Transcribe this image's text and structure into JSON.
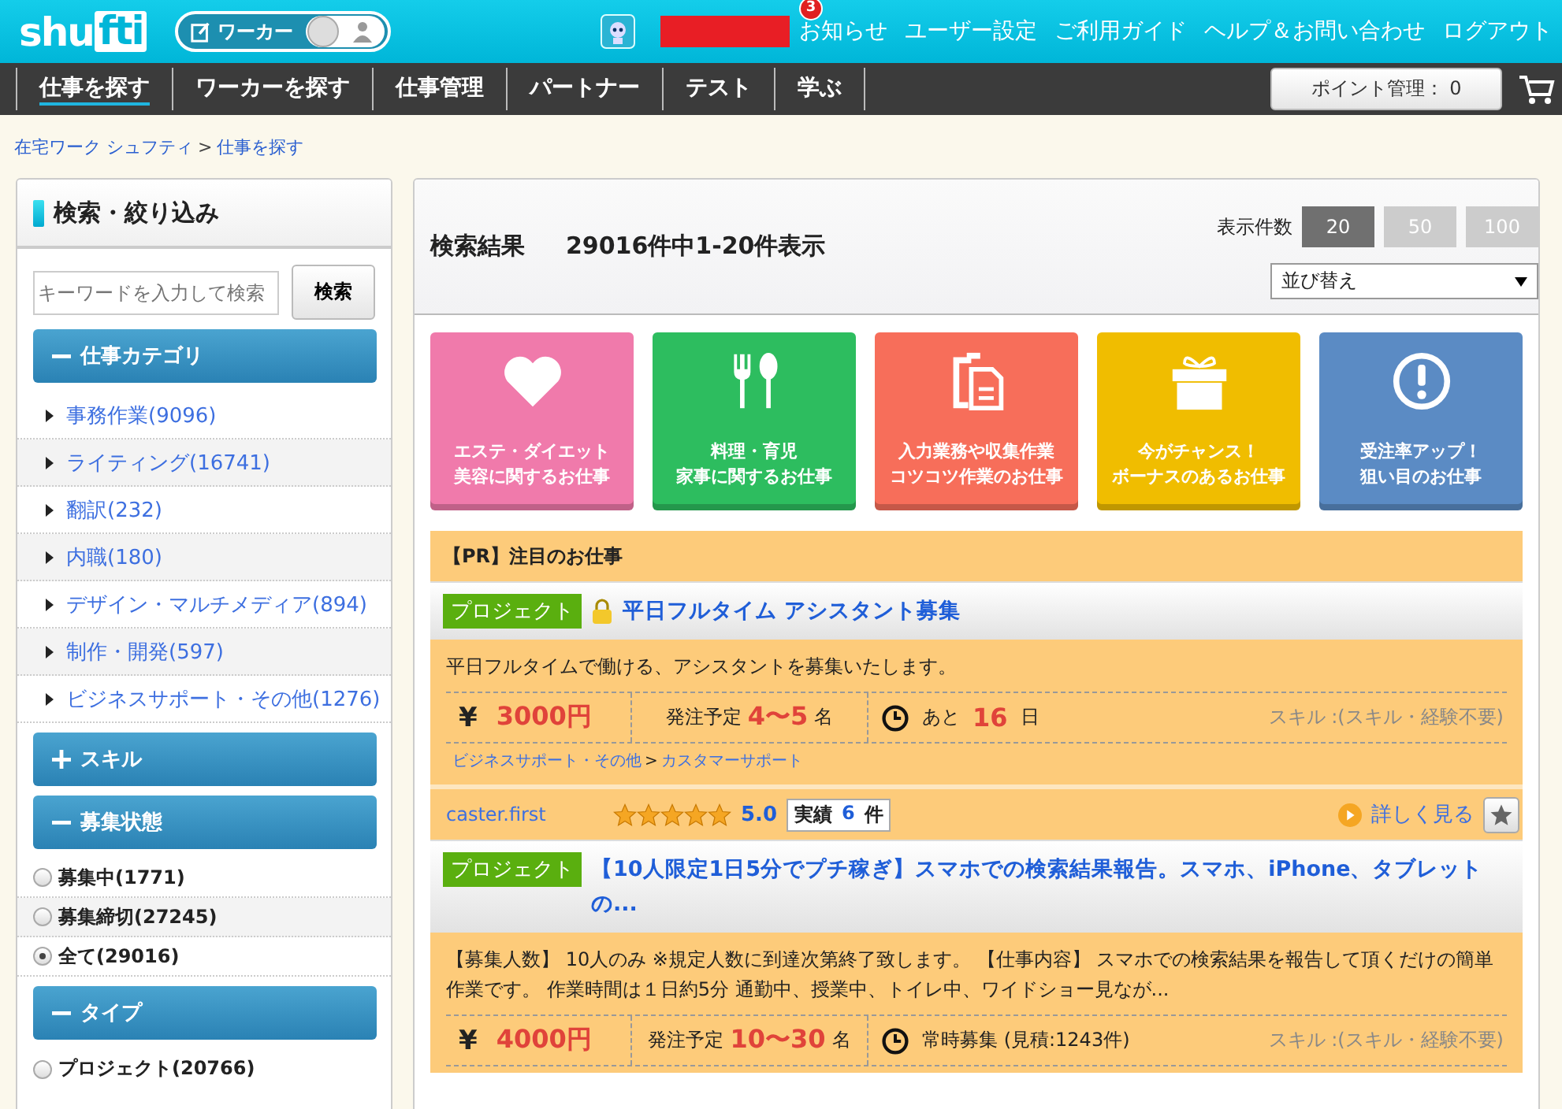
{
  "header": {
    "logo_text": "shu",
    "logo_box": "fti",
    "mode_toggle": {
      "label": "ワーカー",
      "on": false
    },
    "notification_badge": "3",
    "links": [
      "お知らせ",
      "ユーザー設定",
      "ご利用ガイド",
      "ヘルプ＆お問い合わせ",
      "ログアウト"
    ]
  },
  "nav": {
    "tabs": [
      {
        "label": "仕事を探す",
        "selected": true
      },
      {
        "label": "ワーカーを探す",
        "selected": false
      },
      {
        "label": "仕事管理",
        "selected": false
      },
      {
        "label": "パートナー",
        "selected": false
      },
      {
        "label": "テスト",
        "selected": false
      },
      {
        "label": "学ぶ",
        "selected": false
      }
    ],
    "points_button": "ポイント管理： 0"
  },
  "breadcrumb": {
    "separator": ">",
    "items": [
      "在宅ワーク シュフティ",
      "仕事を探す"
    ]
  },
  "sidebar": {
    "title": "検索・絞り込み",
    "search": {
      "placeholder": "キーワードを入力して検索",
      "button": "検索"
    },
    "sections": [
      {
        "title": "仕事カテゴリ",
        "expanded": true,
        "kind": "links",
        "items": [
          {
            "label": "事務作業(9096)"
          },
          {
            "label": "ライティング(16741)"
          },
          {
            "label": "翻訳(232)"
          },
          {
            "label": "内職(180)"
          },
          {
            "label": "デザイン・マルチメディア(894)"
          },
          {
            "label": "制作・開発(597)"
          },
          {
            "label": "ビジネスサポート・その他(1276)"
          }
        ]
      },
      {
        "title": "スキル",
        "expanded": false
      },
      {
        "title": "募集状態",
        "expanded": true,
        "kind": "radios",
        "items": [
          {
            "label": "募集中(1771)",
            "selected": false
          },
          {
            "label": "募集締切(27245)",
            "selected": false
          },
          {
            "label": "全て(29016)",
            "selected": true
          }
        ]
      },
      {
        "title": "タイプ",
        "expanded": true,
        "kind": "radios",
        "items": [
          {
            "label": "プロジェクト(20766)",
            "selected": false
          }
        ]
      }
    ]
  },
  "results": {
    "title": "検索結果",
    "count": "29016件中1-20件表示",
    "per_page_label": "表示件数",
    "per_page": [
      {
        "label": "20",
        "selected": true
      },
      {
        "label": "50",
        "selected": false
      },
      {
        "label": "100",
        "selected": false
      }
    ],
    "sort": {
      "value": "並び替え"
    },
    "tiles": [
      {
        "color": "#f07aab",
        "lines": [
          "エステ・ダイエット",
          "美容に関するお仕事"
        ]
      },
      {
        "color": "#2dbd5f",
        "lines": [
          "料理・育児",
          "家事に関するお仕事"
        ]
      },
      {
        "color": "#f76e5a",
        "lines": [
          "入力業務や収集作業",
          "コツコツ作業のお仕事"
        ]
      },
      {
        "color": "#f0bd00",
        "lines": [
          "今がチャンス！",
          "ボーナスのあるお仕事"
        ]
      },
      {
        "color": "#5b8bc4",
        "lines": [
          "受注率アップ！",
          "狙い目のお仕事"
        ]
      }
    ],
    "pr_heading": "【PR】注目のお仕事",
    "jobs": [
      {
        "type": "プロジェクト",
        "locked": true,
        "title": "平日フルタイム アシスタント募集",
        "description": "平日フルタイムで働ける、アシスタントを募集いたします。",
        "currency": "¥",
        "price": "3000円",
        "order_label": "発注予定",
        "order_count": "4〜5",
        "order_unit": "名",
        "deadline_prefix": "あと",
        "deadline_value": "16",
        "deadline_suffix": "日",
        "skill": "スキル :(スキル・経験不要)",
        "categories": [
          "ビジネスサポート・その他",
          "カスタマーサポート"
        ],
        "category_separator": ">",
        "client": {
          "name": "caster.first",
          "stars": 5,
          "rating": "5.0",
          "record_label": "実績",
          "record_count": "6",
          "record_unit": "件"
        },
        "details": "詳しく見る"
      },
      {
        "type": "プロジェクト",
        "locked": false,
        "title": "【10人限定1日5分でプチ稼ぎ】スマホでの検索結果報告。スマホ、iPhone、タブレットの...",
        "description": "【募集人数】 10人のみ ※規定人数に到達次第終了致します。 【仕事内容】 スマホでの検索結果を報告して頂くだけの簡単作業です。 作業時間は１日約5分 通勤中、授業中、トイレ中、ワイドショー見なが...",
        "currency": "¥",
        "price": "4000円",
        "order_label": "発注予定",
        "order_count": "10〜30",
        "order_unit": "名",
        "deadline_text": "常時募集 (見積:1243件)",
        "skill": "スキル :(スキル・経験不要)"
      }
    ]
  }
}
